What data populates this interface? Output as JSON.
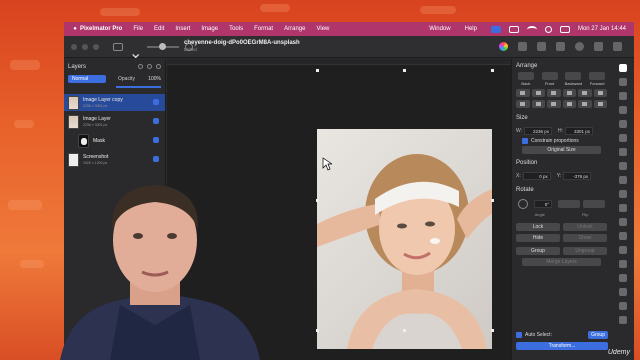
{
  "menubar": {
    "app_name": "Pixelmator Pro",
    "items": [
      "File",
      "Edit",
      "Insert",
      "Image",
      "Tools",
      "Format",
      "Arrange",
      "View",
      "Window",
      "Help"
    ],
    "clock": "Mon 27 Jan 14:44"
  },
  "document": {
    "title": "cheyenne-doig-dPo0OEGrM8A-unsplash",
    "subtitle": "Edited"
  },
  "layers_panel": {
    "title": "Layers",
    "blend_mode": "Normal",
    "opacity_label": "Opacity",
    "opacity_value": "100%",
    "layers": [
      {
        "name": "Image Layer copy",
        "size": "2236 × 3301 px",
        "selected": true
      },
      {
        "name": "Image Layer",
        "size": "2236 × 3301 px",
        "selected": false
      },
      {
        "name": "Mask",
        "size": "",
        "selected": false
      },
      {
        "name": "Screenshot",
        "size": "1920 × 1200 px",
        "selected": false
      }
    ]
  },
  "arrange_panel": {
    "title": "Arrange",
    "order_buttons": [
      "Back",
      "Front",
      "Backward",
      "Forward"
    ],
    "size_title": "Size",
    "width_label": "W:",
    "width_value": "2236 px",
    "height_label": "H:",
    "height_value": "3301 px",
    "constrain_label": "Constrain proportions",
    "original_size_label": "Original Size",
    "position_title": "Position",
    "x_label": "X:",
    "x_value": "0 px",
    "y_label": "Y:",
    "y_value": "-376 px",
    "rotate_title": "Rotate",
    "angle_value": "0°",
    "angle_label": "Angle",
    "flip_label": "Flip",
    "lock_label": "Lock",
    "unlock_label": "Unlock",
    "hide_label": "Hide",
    "show_label": "Show",
    "group_label": "Group",
    "ungroup_label": "Ungroup",
    "merge_label": "Merge Layers",
    "auto_select_label": "Auto Select:",
    "auto_select_value": "Group",
    "transform_label": "Transform..."
  },
  "watermark": "Udemy"
}
